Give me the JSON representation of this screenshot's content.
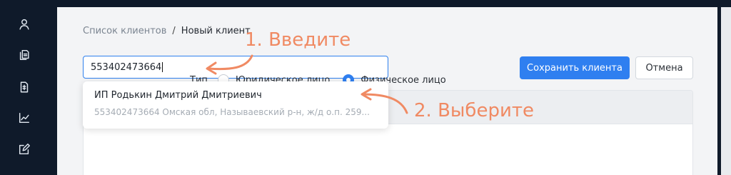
{
  "sidebar": {
    "icons": [
      "user-icon",
      "documents-icon",
      "file-icon",
      "chart-icon",
      "edit-icon"
    ]
  },
  "breadcrumb": {
    "parent": "Список клиентов",
    "separator": "/",
    "current": "Новый клиент"
  },
  "search": {
    "value": "553402473664"
  },
  "toolbar": {
    "save_label": "Сохранить клиента",
    "cancel_label": "Отмена"
  },
  "suggestion": {
    "title": "ИП Родькин Дмитрий Дмитриевич",
    "subtitle": "553402473664 Омская обл, Называевский р-н, ж/д о.п. 259..."
  },
  "form": {
    "type_label": "Тип",
    "options": [
      "Юридическое лицо",
      "Физическое лицо"
    ],
    "selected": "Физическое лицо"
  },
  "annotations": {
    "step1": "1. Введите",
    "step2": "2. Выберите",
    "color": "#f08a63"
  },
  "colors": {
    "accent": "#2f7ff0",
    "sidebar_bg": "#0f1a2a"
  }
}
